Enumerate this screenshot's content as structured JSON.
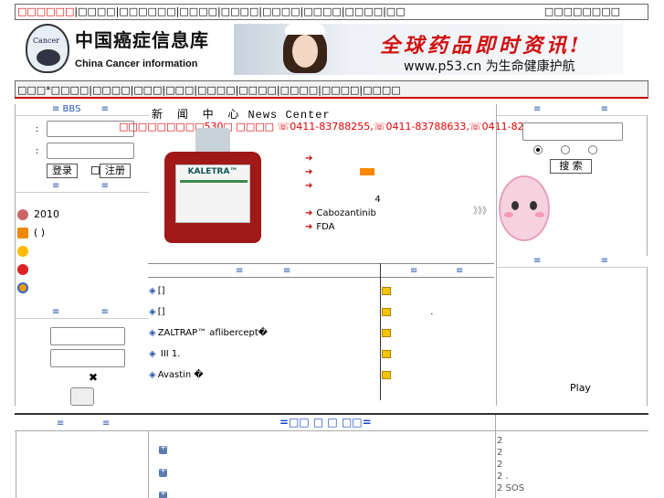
{
  "topbar": {
    "left_red": "□□□□□□",
    "left_rest": "|□□□□|□□□□□□|□□□□|□□□□|□□□□|□□□□|□□□□|□□",
    "right": "□□□□□□□□"
  },
  "logo": {
    "seal_text": "Cancer",
    "cn": "中国癌症信息库",
    "en": "China Cancer information"
  },
  "banner": {
    "slogan": "全球药品即时资讯!",
    "url": "www.p53.cn 为生命健康护航"
  },
  "navbar": {
    "text": "□□□*□□□□|□□□□|□□□|□□□|□□□□|□□□□|□□□□|□□□□|□□□□"
  },
  "headers": {
    "left_a": "≡ BBS",
    "left_b": "≡",
    "right_a": "≡",
    "right_b": "≡"
  },
  "login": {
    "label1": ":",
    "label2": ":",
    "login_label": "登录",
    "register_label": "注册",
    "sub_a": "≡",
    "sub_b": "≡"
  },
  "left_items": [
    "2010",
    "( )",
    "",
    "",
    ""
  ],
  "left_box": {
    "hdr_a": "≡",
    "hdr_b": "≡",
    "check": "✖"
  },
  "news": {
    "title": "新 闻 中 心",
    "title_en": "News Center",
    "marquee": "□□□□□□□□□530□ □□□□ ☏0411-83788255,☏0411-83788633,☏0411-82862611☏",
    "bottle_brand": "KALETRA™",
    "items": [
      "",
      "",
      "",
      "4",
      "Cabozantinib",
      "FDA"
    ],
    "more": "》》》"
  },
  "sub_headers": {
    "a": "≡",
    "b": "≡",
    "c": "≡",
    "d": "≡"
  },
  "articles": [
    "[]",
    "[]",
    "ZALTRAP™ aflibercept�",
    "  III   1.",
    "Avastin       �"
  ],
  "right_articles": [
    "",
    ".",
    "",
    "",
    ""
  ],
  "search": {
    "button_label": "搜 索"
  },
  "right_bottom": {
    "play_label": "Play"
  },
  "bottom": {
    "hdr_a": "≡",
    "hdr_b": "≡",
    "title": "=□□ □ □ □□=",
    "right_items": [
      "2",
      "2",
      "2",
      "2          .",
      "2 SOS"
    ]
  }
}
